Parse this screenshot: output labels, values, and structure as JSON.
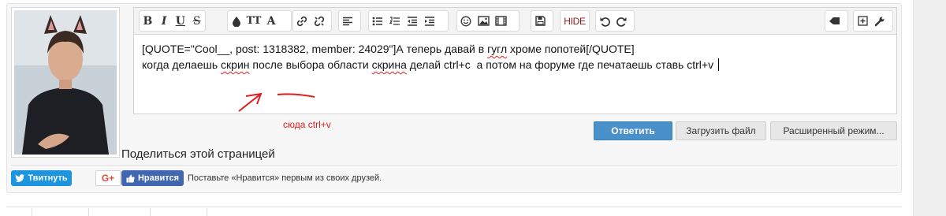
{
  "toolbar": {
    "bold": "B",
    "italic": "I",
    "underline": "U",
    "strike": "S",
    "font_size": "TT",
    "font_family": "A",
    "hide": "HIDE"
  },
  "editor": {
    "line1_a": "[QUOTE=\"Cool__, post: 1318382, member: 24029\"]А теперь давай в ",
    "line1_b": "гугл",
    "line1_c": " хроме попотей[/QUOTE]",
    "line2_a": "когда делаешь ",
    "line2_b": "скрин",
    "line2_c": " после выбора области ",
    "line2_d": "скрина",
    "line2_e": " делай ctrl+c  а потом на форуме где печатаешь ставь ctrl+v "
  },
  "annotation": {
    "text": "сюда ctrl+v",
    "color": "#e01c1c"
  },
  "actions": {
    "reply": "Ответить",
    "upload": "Загрузить файл",
    "advanced": "Расширенный режим..."
  },
  "share": {
    "title": "Поделиться этой страницей",
    "tweet": "Твитнуть",
    "gplus": "G+",
    "like": "Нравится",
    "like_text": "Поставьте «Нравится» первым из своих друзей."
  },
  "colors": {
    "reply_button": "#4a91c9",
    "tweet": "#1b95e0",
    "facebook": "#4267b2"
  }
}
